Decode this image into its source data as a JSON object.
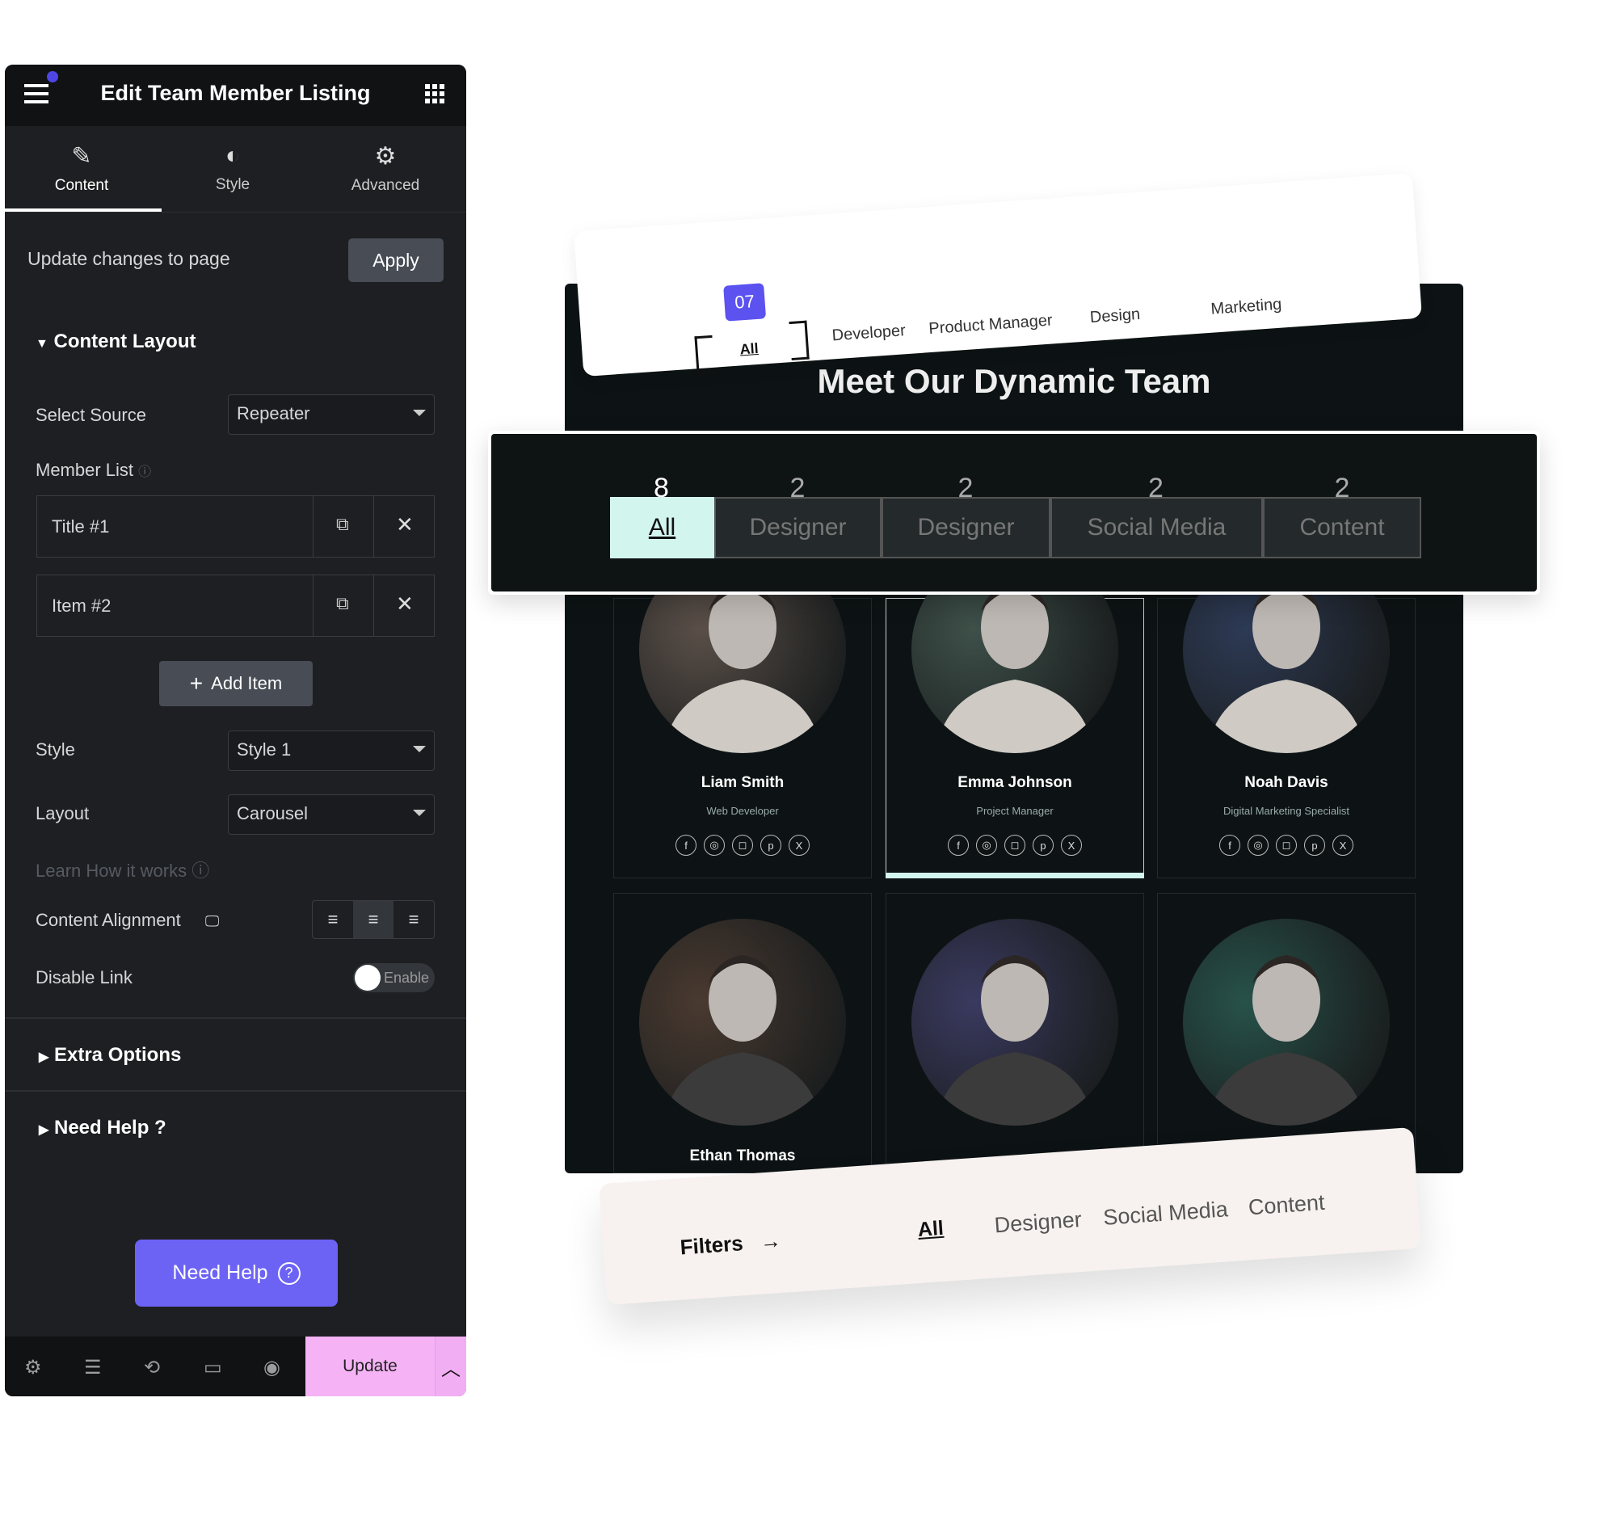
{
  "panel": {
    "title": "Edit Team Member Listing",
    "tabs": [
      {
        "label": "Content",
        "icon": "pencil-icon"
      },
      {
        "label": "Style",
        "icon": "contrast-icon"
      },
      {
        "label": "Advanced",
        "icon": "gear-icon"
      }
    ],
    "update_text": "Update changes to page",
    "apply": "Apply",
    "content_layout": "Content Layout",
    "select_source_label": "Select Source",
    "select_source_value": "Repeater",
    "member_list_label": "Member List",
    "items": [
      {
        "label": "Title #1"
      },
      {
        "label": "Item #2"
      }
    ],
    "add_item": "Add Item",
    "style_label": "Style",
    "style_value": "Style 1",
    "layout_label": "Layout",
    "layout_value": "Carousel",
    "learn": "Learn How it works",
    "alignment_label": "Content Alignment",
    "alignment_selected": "center",
    "disable_link_label": "Disable Link",
    "toggle_text": "Enable",
    "extra_options": "Extra Options",
    "need_help_section": "Need Help ?",
    "need_help_button": "Need Help",
    "update": "Update",
    "colors": {
      "accent": "#6c63f5",
      "update_bg": "#f5b3f5"
    }
  },
  "preview": {
    "top_filter": {
      "badge": "07",
      "items": [
        "All",
        "Developer",
        "Product Manager",
        "Design",
        "Marketing"
      ],
      "active": "All"
    },
    "heading": "Meet Our Dynamic Team",
    "filter": {
      "items": [
        {
          "count": "8",
          "label": "All"
        },
        {
          "count": "2",
          "label": "Designer"
        },
        {
          "count": "2",
          "label": "Designer"
        },
        {
          "count": "2",
          "label": "Social Media"
        },
        {
          "count": "2",
          "label": "Content"
        }
      ],
      "active_color": "#d2f5ee"
    },
    "members": [
      {
        "name": "Liam Smith",
        "role": "Web Developer"
      },
      {
        "name": "Emma Johnson",
        "role": "Project Manager"
      },
      {
        "name": "Noah Davis",
        "role": "Digital Marketing Specialist"
      },
      {
        "name": "Ethan Thomas",
        "role": ""
      },
      {
        "name": "",
        "role": ""
      },
      {
        "name": "",
        "role": ""
      }
    ],
    "bottom_filter": {
      "label": "Filters",
      "items": [
        "All",
        "Designer",
        "Social Media",
        "Content"
      ],
      "active": "All"
    }
  }
}
